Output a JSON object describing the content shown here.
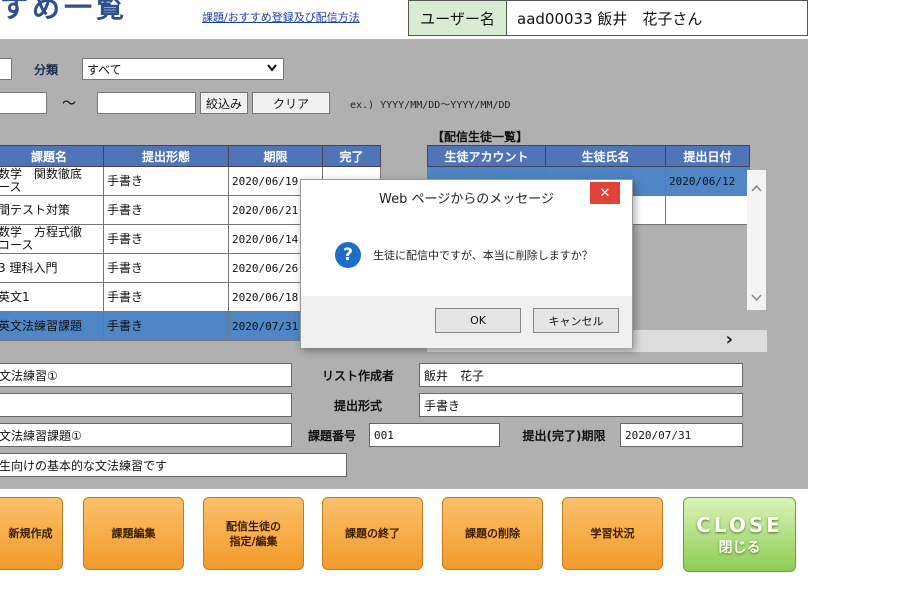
{
  "header": {
    "title": "すめ一覧",
    "help_link": "課題/おすすめ登録及び配信方法",
    "user_label": "ユーザー名",
    "user_value": "aad00033 飯井　花子さん"
  },
  "filter": {
    "category_label": "分類",
    "category_value": "すべて",
    "range_separator": "～",
    "filter_button": "絞込み",
    "clear_button": "クリア",
    "date_example": "ex.) YYYY/MM/DD～YYYY/MM/DD"
  },
  "assignments": {
    "columns": [
      "課題名",
      "提出形態",
      "期限",
      "完了"
    ],
    "rows": [
      {
        "name": "数学　関数徹底\nース",
        "type": "手書き",
        "due": "2020/06/19",
        "done": ""
      },
      {
        "name": "間テスト対策",
        "type": "手書き",
        "due": "2020/06/21",
        "done": ""
      },
      {
        "name": "数学　方程式徹\nコース",
        "type": "手書き",
        "due": "2020/06/14",
        "done": ""
      },
      {
        "name": "3 理科入門",
        "type": "手書き",
        "due": "2020/06/26",
        "done": ""
      },
      {
        "name": "英文1",
        "type": "手書き",
        "due": "2020/06/18",
        "done": ""
      },
      {
        "name": "英文法練習課題",
        "type": "手書き",
        "due": "2020/07/31",
        "done": ""
      }
    ]
  },
  "students": {
    "caption": "【配信生徒一覧】",
    "columns": [
      "生徒アカウント",
      "生徒氏名",
      "提出日付"
    ],
    "rows": [
      {
        "account": "",
        "name": "",
        "date": "2020/06/12"
      },
      {
        "account": "",
        "name": "",
        "date": ""
      }
    ],
    "scroll_next": "›"
  },
  "detail": {
    "name_value": "文法練習①",
    "blank_value": "",
    "title_value": "文法練習課題①",
    "desc_value": "生向けの基本的な文法練習です",
    "list_creator_label": "リスト作成者",
    "list_creator_value": "飯井　花子",
    "submit_format_label": "提出形式",
    "submit_format_value": "手書き",
    "task_number_label": "課題番号",
    "task_number_value": "001",
    "due_label": "提出(完了)期限",
    "due_value": "2020/07/31"
  },
  "buttons": {
    "new": "新規作成",
    "edit": "課題編集",
    "assign": "配信生徒の\n指定/編集",
    "finish": "課題の終了",
    "delete": "課題の削除",
    "status": "学習状況",
    "close_en": "CLOSE",
    "close_ja": "閉じる"
  },
  "dialog": {
    "title": "Web ページからのメッセージ",
    "close_glyph": "✕",
    "icon_glyph": "?",
    "message": "生徒に配信中ですが、本当に削除しますか？",
    "ok": "OK",
    "cancel": "キャンセル"
  },
  "colors": {
    "panel": "#b0b0b0",
    "header_blue": "#4f74b8",
    "selected_row": "#4f86c6",
    "orange_button": "#f29a2c",
    "green_button": "#8dcc52",
    "dialog_close": "#e0433a"
  }
}
